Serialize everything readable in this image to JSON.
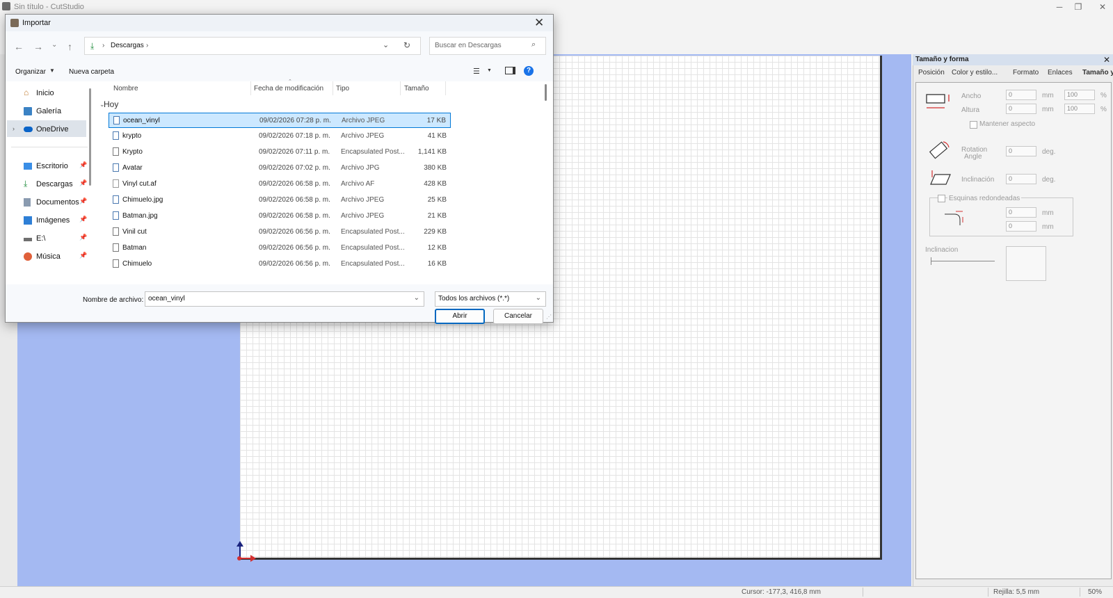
{
  "app": {
    "title": "Sin título - CutStudio",
    "status": {
      "cursor": "Cursor: -177,3, 416,8 mm",
      "grid": "Rejilla: 5,5 mm",
      "zoom": "50%"
    }
  },
  "panel": {
    "title": "Tamaño y forma",
    "tabs": [
      "Posición",
      "Color y estilo...",
      "Formato",
      "Enlaces",
      "Tamaño y for..."
    ],
    "width_label": "Ancho",
    "height_label": "Altura",
    "width_value": "0",
    "height_value": "0",
    "width_pct": "100",
    "height_pct": "100",
    "unit_mm": "mm",
    "unit_pct": "%",
    "keep_aspect": "Mantener aspecto",
    "rotation_label_1": "Rotation",
    "rotation_label_2": "Angle",
    "rotation_value": "0",
    "unit_deg": "deg.",
    "slant_label": "Inclinación",
    "slant_value": "0",
    "rounded_corners": "Esquinas redondeadas",
    "corner_value_1": "0",
    "corner_value_2": "0",
    "slant_section": "Inclinacion"
  },
  "dialog": {
    "title": "Importar",
    "breadcrumb": "Descargas",
    "search_placeholder": "Buscar en Descargas",
    "organize": "Organizar",
    "new_folder": "Nueva carpeta",
    "nav": [
      {
        "label": "Inicio"
      },
      {
        "label": "Galería"
      },
      {
        "label": "OneDrive"
      },
      {
        "label": "Escritorio"
      },
      {
        "label": "Descargas"
      },
      {
        "label": "Documentos"
      },
      {
        "label": "Imágenes"
      },
      {
        "label": "E:\\"
      },
      {
        "label": "Música"
      }
    ],
    "columns": [
      "Nombre",
      "Fecha de modificación",
      "Tipo",
      "Tamaño"
    ],
    "group": "Hoy",
    "files": [
      {
        "name": "ocean_vinyl",
        "date": "09/02/2026 07:28 p. m.",
        "type": "Archivo JPEG",
        "size": "17 KB"
      },
      {
        "name": "krypto",
        "date": "09/02/2026 07:18 p. m.",
        "type": "Archivo JPEG",
        "size": "41 KB"
      },
      {
        "name": "Krypto",
        "date": "09/02/2026 07:11 p. m.",
        "type": "Encapsulated Post...",
        "size": "1,141 KB"
      },
      {
        "name": "Avatar",
        "date": "09/02/2026 07:02 p. m.",
        "type": "Archivo JPG",
        "size": "380 KB"
      },
      {
        "name": "Vinyl cut.af",
        "date": "09/02/2026 06:58 p. m.",
        "type": "Archivo AF",
        "size": "428 KB"
      },
      {
        "name": "Chimuelo.jpg",
        "date": "09/02/2026 06:58 p. m.",
        "type": "Archivo JPEG",
        "size": "25 KB"
      },
      {
        "name": "Batman.jpg",
        "date": "09/02/2026 06:58 p. m.",
        "type": "Archivo JPEG",
        "size": "21 KB"
      },
      {
        "name": "Vinil cut",
        "date": "09/02/2026 06:56 p. m.",
        "type": "Encapsulated Post...",
        "size": "229 KB"
      },
      {
        "name": "Batman",
        "date": "09/02/2026 06:56 p. m.",
        "type": "Encapsulated Post...",
        "size": "12 KB"
      },
      {
        "name": "Chimuelo",
        "date": "09/02/2026 06:56 p. m.",
        "type": "Encapsulated Post...",
        "size": "16 KB"
      }
    ],
    "filename_label": "Nombre de archivo:",
    "filename_value": "ocean_vinyl",
    "filter": "Todos los archivos (*.*)",
    "open": "Abrir",
    "cancel": "Cancelar"
  }
}
